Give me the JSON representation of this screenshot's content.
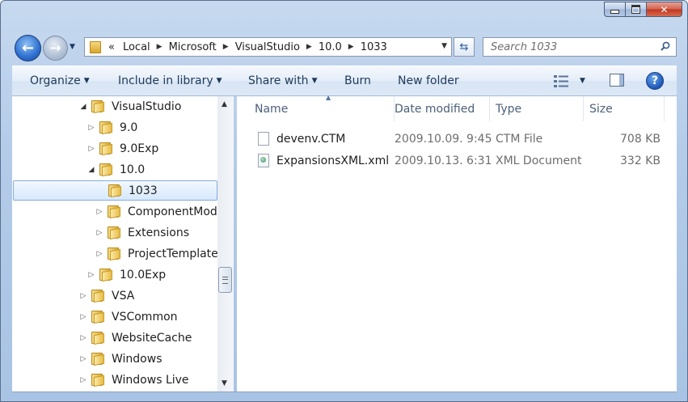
{
  "window": {
    "caption_buttons": {
      "minimize": "minimize",
      "maximize": "maximize",
      "close": "✕"
    }
  },
  "address": {
    "overflow": "«",
    "crumbs": [
      "Local",
      "Microsoft",
      "VisualStudio",
      "10.0",
      "1033"
    ]
  },
  "search": {
    "placeholder": "Search 1033"
  },
  "toolbar": {
    "organize": "Organize",
    "include_in_library": "Include in library",
    "share_with": "Share with",
    "burn": "Burn",
    "new_folder": "New folder"
  },
  "tree": {
    "items": [
      {
        "label": "VisualStudio",
        "expanded": true,
        "level": 1
      },
      {
        "label": "9.0",
        "expanded": false,
        "level": 2
      },
      {
        "label": "9.0Exp",
        "expanded": false,
        "level": 2
      },
      {
        "label": "10.0",
        "expanded": true,
        "level": 2
      },
      {
        "label": "1033",
        "selected": true,
        "level": 3
      },
      {
        "label": "ComponentModel",
        "expanded": false,
        "level": 3
      },
      {
        "label": "Extensions",
        "expanded": false,
        "level": 3
      },
      {
        "label": "ProjectTemplatesC",
        "expanded": false,
        "level": 3
      },
      {
        "label": "10.0Exp",
        "expanded": false,
        "level": 2
      },
      {
        "label": "VSA",
        "expanded": false,
        "level": 1
      },
      {
        "label": "VSCommon",
        "expanded": false,
        "level": 1
      },
      {
        "label": "WebsiteCache",
        "expanded": false,
        "level": 1
      },
      {
        "label": "Windows",
        "expanded": false,
        "level": 1
      },
      {
        "label": "Windows Live",
        "expanded": false,
        "level": 1
      }
    ]
  },
  "columns": {
    "name": "Name",
    "date": "Date modified",
    "type": "Type",
    "size": "Size"
  },
  "files": [
    {
      "name": "devenv.CTM",
      "date": "2009.10.09. 9:45",
      "type": "CTM File",
      "size": "708 KB",
      "icon": "generic-file-icon"
    },
    {
      "name": "ExpansionsXML.xml",
      "date": "2009.10.13. 6:31",
      "type": "XML Document",
      "size": "332 KB",
      "icon": "xml-file-icon"
    }
  ]
}
